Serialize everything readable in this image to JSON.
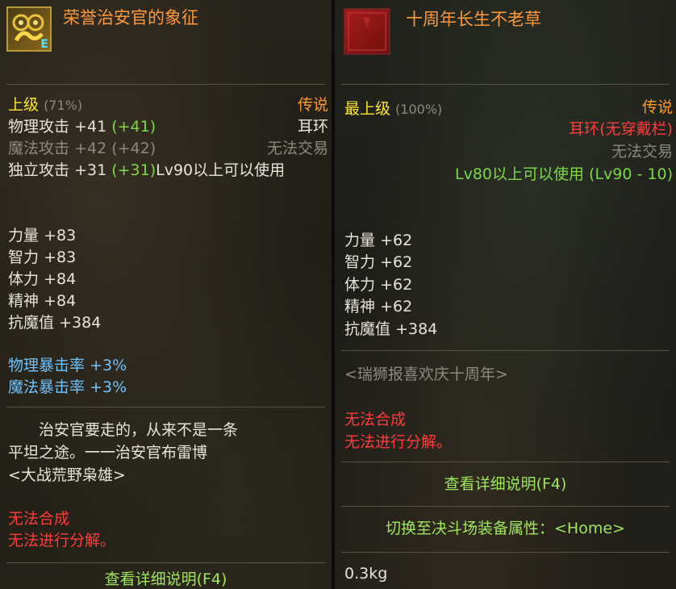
{
  "left": {
    "title": "荣誉治安官的象征",
    "icon_badge": "E",
    "grade": "上级",
    "grade_pct": "(71%)",
    "rarity": "传说",
    "slot": "耳环",
    "trade": "无法交易",
    "level_req": "Lv90以上可以使用",
    "attack_lines": [
      {
        "label": "物理攻击",
        "value": "+41",
        "bonus": "(+41)"
      },
      {
        "label": "魔法攻击",
        "value": "+42",
        "bonus": "(+42)"
      },
      {
        "label": "独立攻击",
        "value": "+31",
        "bonus": "(+31)"
      }
    ],
    "stats": [
      {
        "label": "力量",
        "value": "+83"
      },
      {
        "label": "智力",
        "value": "+83"
      },
      {
        "label": "体力",
        "value": "+84"
      },
      {
        "label": "精神",
        "value": "+84"
      },
      {
        "label": "抗魔值",
        "value": "+384"
      }
    ],
    "crit": [
      {
        "label": "物理暴击率",
        "value": "+3%"
      },
      {
        "label": "魔法暴击率",
        "value": "+3%"
      }
    ],
    "flavor": [
      "治安官要走的，从来不是一条",
      "平坦之途。一一治安官布雷博",
      "<大战荒野枭雄>"
    ],
    "restrictions": [
      "无法合成",
      "无法进行分解。"
    ],
    "detail": "查看详细说明(F4)"
  },
  "right": {
    "title": "十周年长生不老草",
    "grade": "最上级",
    "grade_pct": "(100%)",
    "rarity": "传说",
    "slot": "耳环(无穿戴栏)",
    "trade": "无法交易",
    "level_req": "Lv80以上可以使用 (Lv90 - 10)",
    "stats": [
      {
        "label": "力量",
        "value": "+62"
      },
      {
        "label": "智力",
        "value": "+62"
      },
      {
        "label": "体力",
        "value": "+62"
      },
      {
        "label": "精神",
        "value": "+62"
      },
      {
        "label": "抗魔值",
        "value": "+384"
      }
    ],
    "set_name": "<瑞狮报喜欢庆十周年>",
    "restrictions": [
      "无法合成",
      "无法进行分解。"
    ],
    "detail": "查看详细说明(F4)",
    "switch": "切换至决斗场装备属性：<Home>",
    "weight": "0.3kg"
  },
  "colors": {
    "title": "#ff9a3c",
    "grade": "#ffe632",
    "rarity": "#ff9a2a",
    "bonus": "#7cd848",
    "crit": "#6ec3ff",
    "restriction": "#ff3c3c",
    "disabled": "#8e8a80"
  }
}
